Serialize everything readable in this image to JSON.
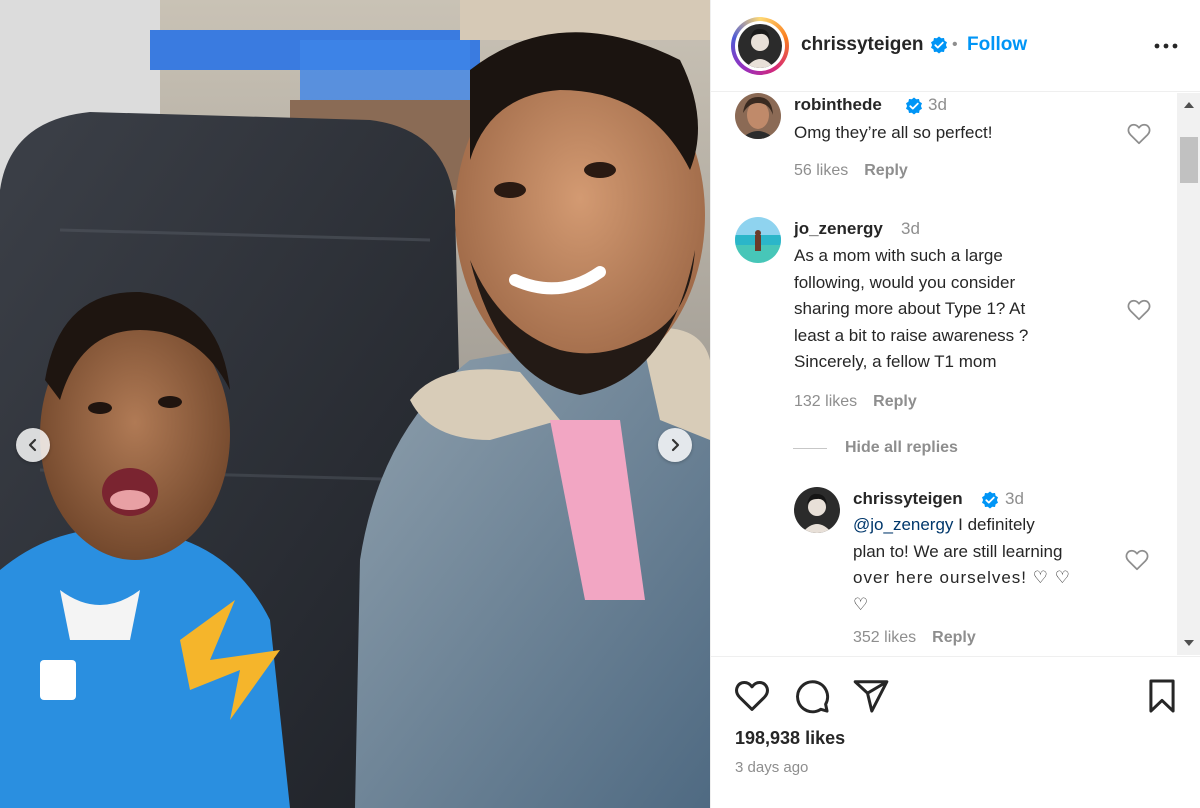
{
  "post": {
    "author": "chrissyteigen",
    "follow_label": "Follow",
    "separator": "•",
    "likes": "198,938 likes",
    "time": "3 days ago"
  },
  "comments": [
    {
      "user": "robinthede",
      "verified": true,
      "time": "3d",
      "text": "Omg they’re all so perfect!",
      "likes": "56 likes",
      "reply_label": "Reply"
    },
    {
      "user": "jo_zenergy",
      "verified": false,
      "time": "3d",
      "text_lines": [
        "As a mom with such a large",
        "following, would you consider",
        "sharing more about Type 1? At",
        "least a bit to raise awareness ?",
        "Sincerely, a fellow T1 mom"
      ],
      "likes": "132 likes",
      "reply_label": "Reply",
      "hide_replies_label": "Hide all replies"
    }
  ],
  "reply": {
    "user": "chrissyteigen",
    "verified": true,
    "time": "3d",
    "mention": "@jo_zenergy",
    "text_line1": " I definitely",
    "text_line2": "plan to! We are still learning",
    "text_line3": "over here ourselves! ♡ ♡",
    "text_line4": "♡",
    "likes": "352 likes",
    "reply_label": "Reply"
  },
  "colors": {
    "accent": "#0095f6",
    "verified": "#0095f6",
    "muted": "#8e8e8e",
    "text": "#262626"
  },
  "icons": [
    "verified-badge-icon",
    "more-options-icon",
    "heart-icon",
    "comment-icon",
    "share-icon",
    "bookmark-icon",
    "chevron-left-icon",
    "chevron-right-icon",
    "scroll-up-icon",
    "scroll-down-icon"
  ]
}
